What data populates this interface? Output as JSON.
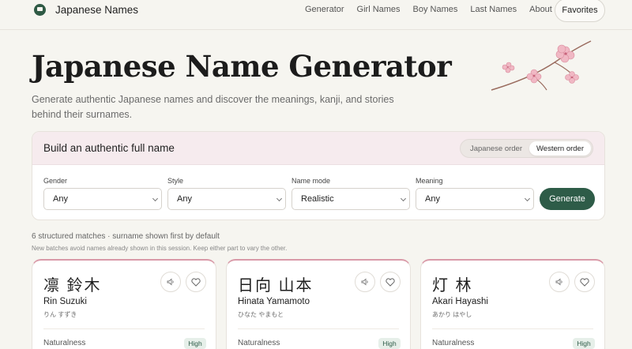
{
  "nav": {
    "brand": "Japanese Names",
    "links": [
      "Generator",
      "Girl Names",
      "Boy Names",
      "Last Names",
      "About"
    ],
    "favorites": "Favorites"
  },
  "hero": {
    "title": "Japanese Name Generator",
    "subtitle": "Generate authentic Japanese names and discover the meanings, kanji, and stories behind their surnames."
  },
  "builder": {
    "title": "Build an authentic full name",
    "order_options": [
      "Japanese order",
      "Western order"
    ],
    "selected_order": "Western order",
    "fields": [
      {
        "label": "Gender",
        "value": "Any"
      },
      {
        "label": "Style",
        "value": "Any"
      },
      {
        "label": "Name mode",
        "value": "Realistic"
      },
      {
        "label": "Meaning",
        "value": "Any"
      }
    ],
    "generate": "Generate"
  },
  "results": {
    "summary": "6 structured matches · surname shown first by default",
    "note": "New batches avoid names already shown in this session. Keep either part to vary the other.",
    "cards": [
      {
        "kanji": "凛 鈴木",
        "romaji": "Rin Suzuki",
        "kana": "りん すずき",
        "naturalness_label": "Naturalness",
        "naturalness": "High"
      },
      {
        "kanji": "日向 山本",
        "romaji": "Hinata Yamamoto",
        "kana": "ひなた やまもと",
        "naturalness_label": "Naturalness",
        "naturalness": "High"
      },
      {
        "kanji": "灯 林",
        "romaji": "Akari Hayashi",
        "kana": "あかり はやし",
        "naturalness_label": "Naturalness",
        "naturalness": "High"
      }
    ]
  },
  "colors": {
    "accent": "#2e5c48",
    "card_border_top": "#d99aa8",
    "header_tint": "#f6ebee",
    "blossom": "#f0b8c4"
  }
}
